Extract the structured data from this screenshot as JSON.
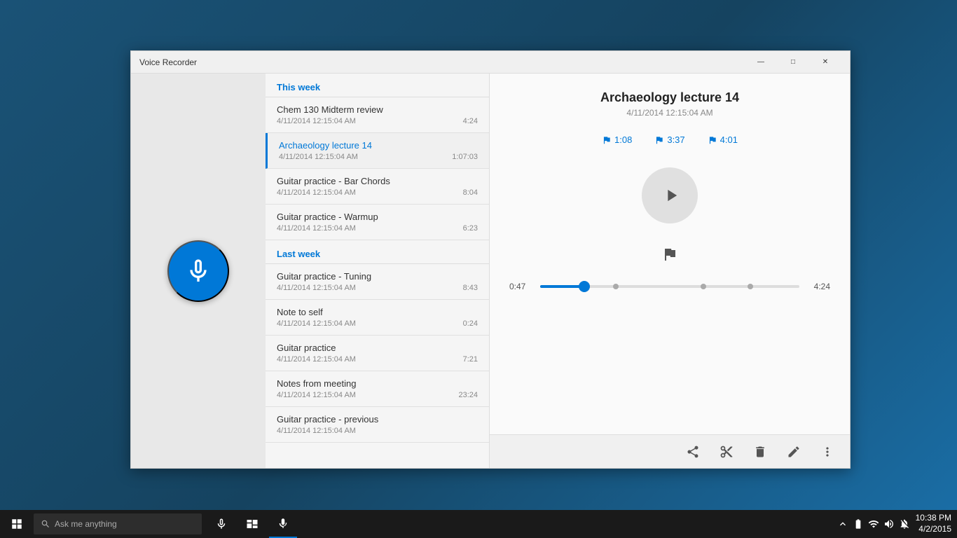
{
  "window": {
    "title": "Voice Recorder",
    "minimize_label": "—",
    "maximize_label": "□",
    "close_label": "✕"
  },
  "player": {
    "title": "Archaeology lecture 14",
    "date": "4/11/2014 12:15:04 AM",
    "markers": [
      {
        "time": "1:08"
      },
      {
        "time": "3:37"
      },
      {
        "time": "4:01"
      }
    ],
    "current_time": "0:47",
    "end_time": "4:24",
    "progress_percent": 17
  },
  "list": {
    "this_week_label": "This week",
    "last_week_label": "Last week",
    "this_week_items": [
      {
        "name": "Chem 130 Midterm review",
        "date": "4/11/2014 12:15:04 AM",
        "duration": "4:24",
        "active": false
      },
      {
        "name": "Archaeology lecture 14",
        "date": "4/11/2014 12:15:04 AM",
        "duration": "1:07:03",
        "active": true
      },
      {
        "name": "Guitar practice - Bar Chords",
        "date": "4/11/2014 12:15:04 AM",
        "duration": "8:04",
        "active": false
      },
      {
        "name": "Guitar practice - Warmup",
        "date": "4/11/2014 12:15:04 AM",
        "duration": "6:23",
        "active": false
      }
    ],
    "last_week_items": [
      {
        "name": "Guitar practice - Tuning",
        "date": "4/11/2014 12:15:04 AM",
        "duration": "8:43"
      },
      {
        "name": "Note to self",
        "date": "4/11/2014 12:15:04 AM",
        "duration": "0:24"
      },
      {
        "name": "Guitar practice",
        "date": "4/11/2014 12:15:04 AM",
        "duration": "7:21"
      },
      {
        "name": "Notes from meeting",
        "date": "4/11/2014 12:15:04 AM",
        "duration": "23:24"
      },
      {
        "name": "Guitar practice - previous",
        "date": "4/11/2014 12:15:04 AM",
        "duration": ""
      }
    ]
  },
  "toolbar": {
    "share_label": "Share",
    "trim_label": "Trim",
    "delete_label": "Delete",
    "rename_label": "Rename",
    "more_label": "More"
  },
  "taskbar": {
    "search_placeholder": "Ask me anything",
    "time": "10:38 PM",
    "date": "4/2/2015"
  }
}
